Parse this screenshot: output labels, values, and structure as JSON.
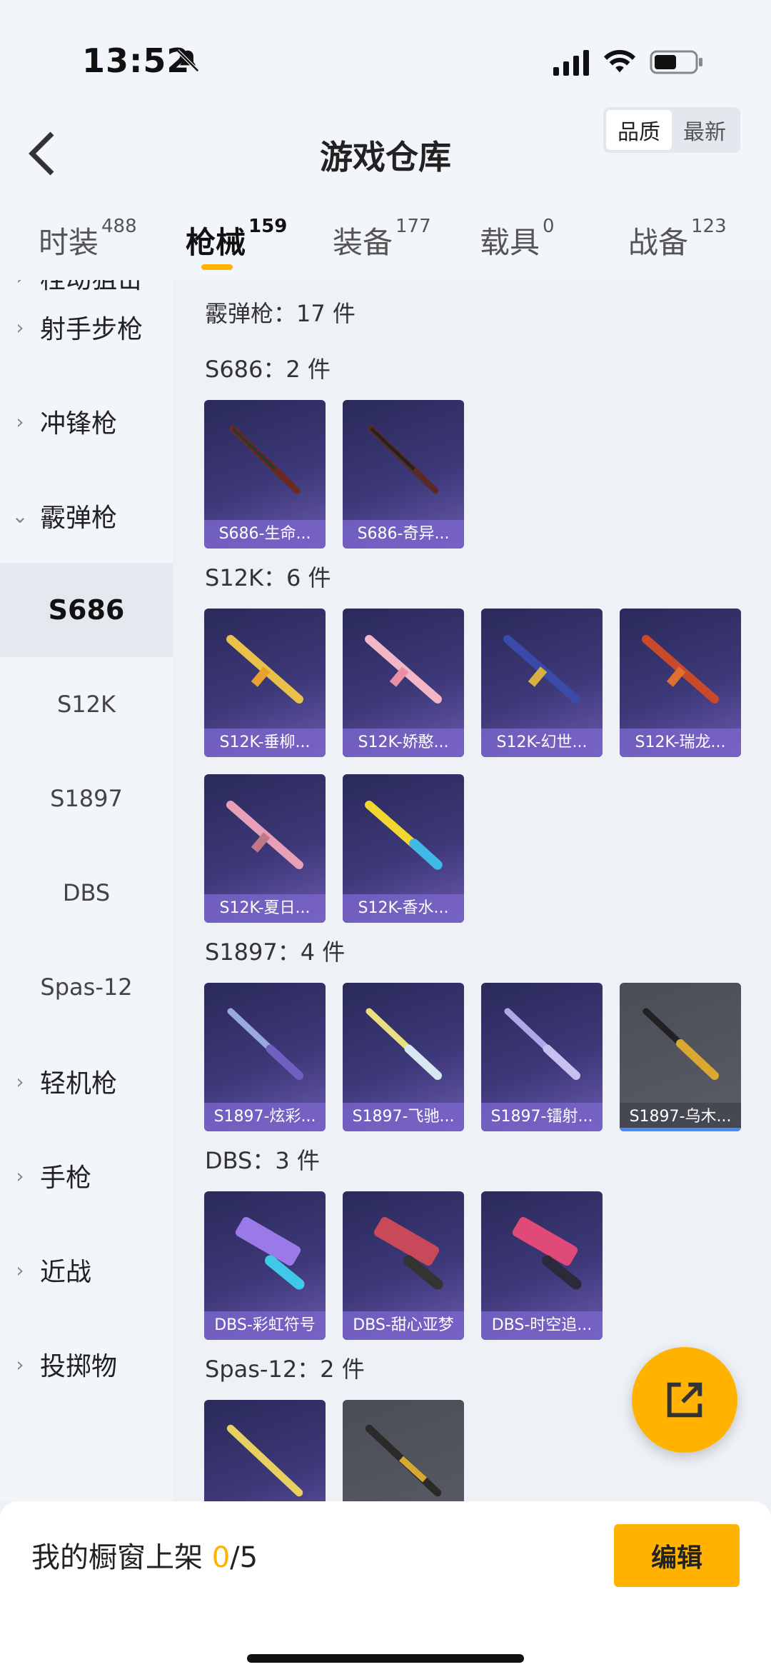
{
  "status": {
    "time": "13:52"
  },
  "header": {
    "title": "游戏仓库",
    "sort_quality": "品质",
    "sort_newest": "最新"
  },
  "tabs": [
    {
      "label": "时装",
      "count": "488"
    },
    {
      "label": "枪械",
      "count": "159"
    },
    {
      "label": "装备",
      "count": "177"
    },
    {
      "label": "载具",
      "count": "0"
    },
    {
      "label": "战备",
      "count": "123"
    }
  ],
  "sidebar": {
    "cut_item": "栓动狙击",
    "items": [
      {
        "label": "射手步枪"
      },
      {
        "label": "冲锋枪"
      },
      {
        "label": "霰弹枪"
      },
      {
        "label": "轻机枪"
      },
      {
        "label": "手枪"
      },
      {
        "label": "近战"
      },
      {
        "label": "投掷物"
      }
    ],
    "sub_items": [
      "S686",
      "S12K",
      "S1897",
      "DBS",
      "Spas-12"
    ]
  },
  "content": {
    "category_total": "霰弹枪：17 件",
    "sections": [
      {
        "title": "S686：2 件",
        "items": [
          "S686-生命...",
          "S686-奇异..."
        ]
      },
      {
        "title": "S12K：6 件",
        "items": [
          "S12K-垂柳...",
          "S12K-娇憨...",
          "S12K-幻世...",
          "S12K-瑞龙...",
          "S12K-夏日...",
          "S12K-香水..."
        ]
      },
      {
        "title": "S1897：4 件",
        "items": [
          "S1897-炫彩...",
          "S1897-飞驰...",
          "S1897-镭射...",
          "S1897-乌木..."
        ]
      },
      {
        "title": "DBS：3 件",
        "items": [
          "DBS-彩虹符号",
          "DBS-甜心亚梦",
          "DBS-时空追..."
        ]
      },
      {
        "title": "Spas-12：2 件",
        "items": [
          "",
          ""
        ]
      }
    ]
  },
  "bottom": {
    "showcase_label": "我的橱窗上架 ",
    "showcase_count": "0",
    "showcase_total": "/5",
    "edit_label": "编辑"
  },
  "colors": {
    "accent": "#ffb300",
    "card_purple": "#3d3878",
    "card_grey": "#5a5d66"
  }
}
